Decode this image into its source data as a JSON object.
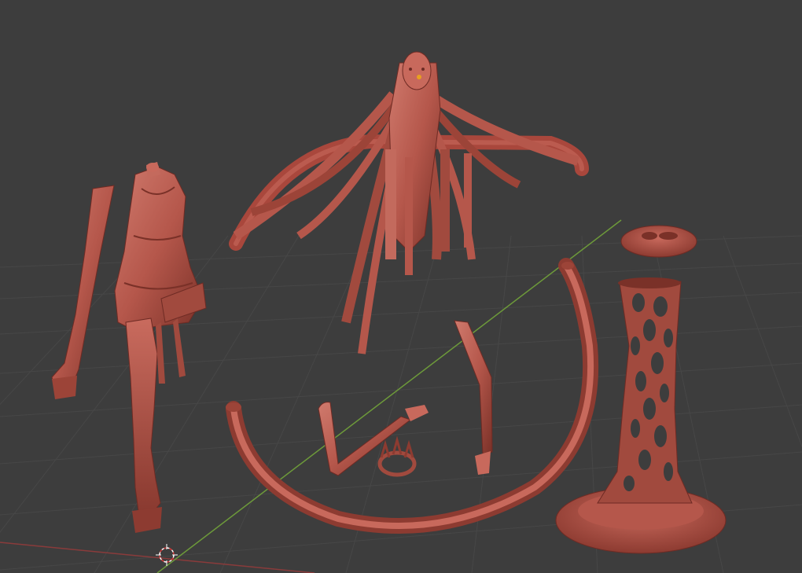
{
  "viewport": {
    "background": "#3d3d3d",
    "grid_color": "#4a4a4a",
    "x_axis_color": "#8a3b3b",
    "y_axis_color": "#6d9a3a",
    "model_color": "#b5574b",
    "model_shadow": "#6e2b24",
    "model_highlight": "#d9867a"
  },
  "scene": {
    "objects": [
      {
        "name": "figure-body-with-legs"
      },
      {
        "name": "head-with-hair"
      },
      {
        "name": "curved-ring-prop"
      },
      {
        "name": "left-arm"
      },
      {
        "name": "right-arm"
      },
      {
        "name": "small-crown"
      },
      {
        "name": "lattice-column-stand"
      },
      {
        "name": "round-base"
      },
      {
        "name": "top-cap-disc"
      }
    ]
  }
}
